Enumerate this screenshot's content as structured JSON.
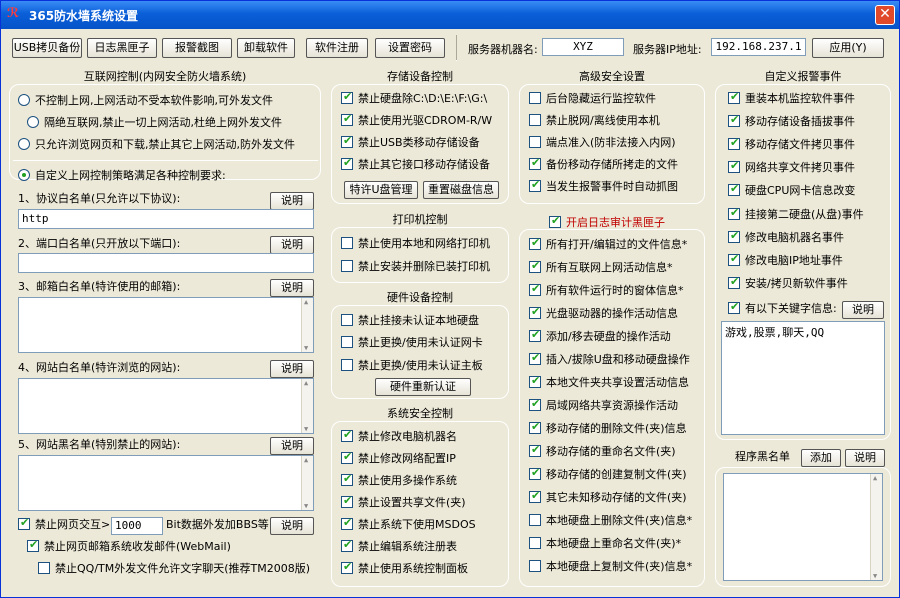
{
  "window": {
    "title": "365防水墙系统设置",
    "logo_icon": "365-logo-icon",
    "close_label": "✕"
  },
  "toolbar": {
    "usb_backup": "USB拷贝备份",
    "log_box": "日志黑匣子",
    "alarm_capture": "报警截图",
    "uninstall": "卸载软件",
    "register": "软件注册",
    "set_password": "设置密码",
    "server_name_label": "服务器机器名:",
    "server_name_value": "XYZ",
    "server_ip_label": "服务器IP地址:",
    "server_ip_value": "192.168.237.1",
    "apply": "应用(Y)"
  },
  "internet": {
    "header": "互联网控制(内网安全防火墙系统)",
    "radios": [
      {
        "label": "不控制上网,上网活动不受本软件影响,可外发文件",
        "checked": false
      },
      {
        "label": "隔绝互联网,禁止一切上网活动,杜绝上网外发文件",
        "checked": false
      },
      {
        "label": "只允许浏览网页和下载,禁止其它上网活动,防外发文件",
        "checked": false
      },
      {
        "label": "自定义上网控制策略满足各种控制要求:",
        "checked": true
      }
    ],
    "protocol_label": "1、协议白名单(只允许以下协议):",
    "protocol_value": "http",
    "port_label": "2、端口白名单(只开放以下端口):",
    "port_value": "",
    "mail_label": "3、邮箱白名单(特许使用的邮箱):",
    "site_white_label": "4、网站白名单(特许浏览的网站):",
    "site_black_label": "5、网站黑名单(特别禁止的网站):",
    "explain": "说明",
    "web_post_label": "禁止网页交互>",
    "web_post_value": "1000",
    "web_post_suffix": "Bit数据外发加BBS等",
    "web_post_checked": true,
    "webmail_label": "禁止网页邮箱系统收发邮件(WebMail)",
    "webmail_checked": true,
    "qq_label": "禁止QQ/TM外发文件允许文字聊天(推荐TM2008版)",
    "qq_checked": false
  },
  "storage": {
    "header": "存储设备控制",
    "items": [
      {
        "label": "禁止硬盘除C:\\D:\\E:\\F:\\G:\\",
        "checked": true
      },
      {
        "label": "禁止使用光驱CDROM-R/W",
        "checked": true
      },
      {
        "label": "禁止USB类移动存储设备",
        "checked": true
      },
      {
        "label": "禁止其它接口移动存储设备",
        "checked": true
      }
    ],
    "special_u": "特许U盘管理",
    "reset_disk": "重置磁盘信息"
  },
  "printer": {
    "header": "打印机控制",
    "items": [
      {
        "label": "禁止使用本地和网络打印机",
        "checked": false
      },
      {
        "label": "禁止安装并删除已装打印机",
        "checked": false
      }
    ]
  },
  "hardware": {
    "header": "硬件设备控制",
    "items": [
      {
        "label": "禁止挂接未认证本地硬盘",
        "checked": false
      },
      {
        "label": "禁止更换/使用未认证网卡",
        "checked": false
      },
      {
        "label": "禁止更换/使用未认证主板",
        "checked": false
      }
    ],
    "reauth": "硬件重新认证"
  },
  "syssec": {
    "header": "系统安全控制",
    "items": [
      {
        "label": "禁止修改电脑机器名",
        "checked": true
      },
      {
        "label": "禁止修改网络配置IP",
        "checked": true
      },
      {
        "label": "禁止使用多操作系统",
        "checked": true
      },
      {
        "label": "禁止设置共享文件(夹)",
        "checked": true
      },
      {
        "label": "禁止系统下使用MSDOS",
        "checked": true
      },
      {
        "label": "禁止编辑系统注册表",
        "checked": true
      },
      {
        "label": "禁止使用系统控制面板",
        "checked": true
      }
    ]
  },
  "advanced": {
    "header": "高级安全设置",
    "items": [
      {
        "label": "后台隐藏运行监控软件",
        "checked": false
      },
      {
        "label": "禁止脱网/离线使用本机",
        "checked": false
      },
      {
        "label": "端点准入(防非法接入内网)",
        "checked": false
      },
      {
        "label": "备份移动存储所拷走的文件",
        "checked": true
      },
      {
        "label": "当发生报警事件时自动抓图",
        "checked": true
      }
    ]
  },
  "audit": {
    "header": "开启日志审计黑匣子",
    "header_checked": true,
    "items": [
      {
        "label": "所有打开/编辑过的文件信息*",
        "checked": true
      },
      {
        "label": "所有互联网上网活动信息*",
        "checked": true
      },
      {
        "label": "所有软件运行时的窗体信息*",
        "checked": true
      },
      {
        "label": "光盘驱动器的操作活动信息",
        "checked": true
      },
      {
        "label": "添加/移去硬盘的操作活动",
        "checked": true
      },
      {
        "label": "插入/拔除U盘和移动硬盘操作",
        "checked": true
      },
      {
        "label": "本地文件夹共享设置活动信息",
        "checked": true
      },
      {
        "label": "局域网络共享资源操作活动",
        "checked": true
      },
      {
        "label": "移动存储的删除文件(夹)信息",
        "checked": true
      },
      {
        "label": "移动存储的重命名文件(夹)",
        "checked": true
      },
      {
        "label": "移动存储的创建复制文件(夹)",
        "checked": true
      },
      {
        "label": "其它未知移动存储的文件(夹)",
        "checked": true
      },
      {
        "label": "本地硬盘上删除文件(夹)信息*",
        "checked": false
      },
      {
        "label": "本地硬盘上重命名文件(夹)*",
        "checked": false
      },
      {
        "label": "本地硬盘上复制文件(夹)信息*",
        "checked": false
      }
    ]
  },
  "alarm": {
    "header": "自定义报警事件",
    "items": [
      {
        "label": "重装本机监控软件事件",
        "checked": true
      },
      {
        "label": "移动存储设备插拔事件",
        "checked": true
      },
      {
        "label": "移动存储文件拷贝事件",
        "checked": true
      },
      {
        "label": "网络共享文件拷贝事件",
        "checked": true
      },
      {
        "label": "硬盘CPU网卡信息改变",
        "checked": true
      },
      {
        "label": "挂接第二硬盘(从盘)事件",
        "checked": true
      },
      {
        "label": "修改电脑机器名事件",
        "checked": true
      },
      {
        "label": "修改电脑IP地址事件",
        "checked": true
      },
      {
        "label": "安装/拷贝新软件事件",
        "checked": true
      }
    ],
    "keyword_label": "有以下关键字信息:",
    "keyword_checked": true,
    "keyword_value": "游戏,股票,聊天,QQ",
    "explain": "说明"
  },
  "blacklist": {
    "header": "程序黑名单",
    "add": "添加",
    "explain": "说明"
  }
}
